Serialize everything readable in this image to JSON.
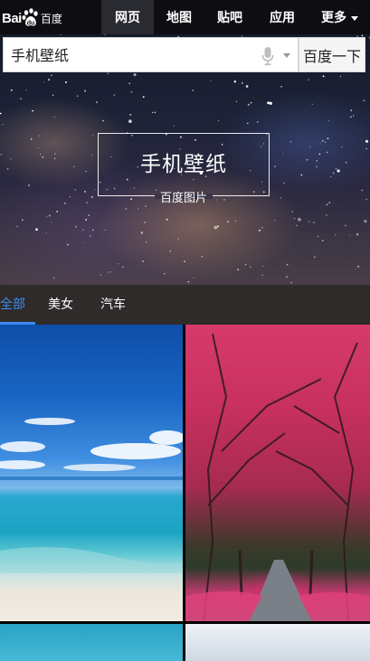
{
  "logo": {
    "latin": "Bai",
    "paw": "paw-icon",
    "cn": "百度"
  },
  "nav": {
    "web": "网页",
    "map": "地图",
    "tieba": "贴吧",
    "apps": "应用",
    "more": "更多"
  },
  "search": {
    "value": "手机壁纸",
    "button": "百度一下",
    "mic_icon": "microphone-icon"
  },
  "hero": {
    "title": "手机壁纸",
    "subtitle": "百度图片"
  },
  "filters": {
    "all": "全部",
    "beauty": "美女",
    "car": "汽车",
    "active_color": "#3d8bf2"
  }
}
